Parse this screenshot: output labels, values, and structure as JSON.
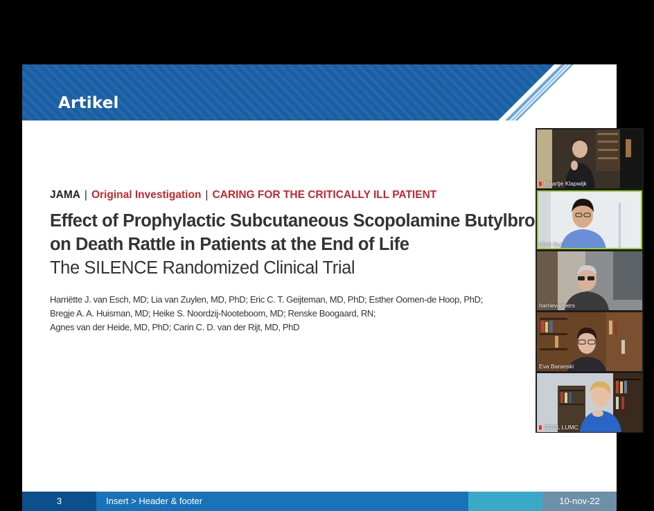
{
  "slide": {
    "title": "Artikel",
    "journal": "JAMA",
    "separator": "|",
    "category_1": "Original Investigation",
    "category_2": "CARING FOR THE CRITICALLY ILL PATIENT",
    "article_title_line_1": "Effect of Prophylactic Subcutaneous Scopolamine Butylbromide",
    "article_title_line_2": "on Death Rattle in Patients at the End of Life",
    "article_subtitle": "The SILENCE Randomized Clinical Trial",
    "authors": [
      "Harriëtte J. van Esch, MD; Lia van Zuylen, MD, PhD; Eric C. T. Geijteman, MD, PhD; Esther Oomen-de Hoop, PhD;",
      "Bregje A. A. Huisman, MD; Heike S. Noordzij-Nooteboom, MD; Renske Boogaard, RN;",
      "Agnes van der Heide, MD, PhD; Carin C. D. van der Rijt, MD, PhD"
    ],
    "footer": {
      "page_number": "3",
      "footer_text": "Insert > Header & footer",
      "date": "10-nov-22"
    }
  },
  "colors": {
    "header_blue": "#1b5fa3",
    "header_stripe": "#6fa8d8",
    "journal_red": "#c0282e",
    "footer_dark_blue": "#0b4f8c",
    "footer_blue": "#1a73b9",
    "footer_teal": "#3aa9c8",
    "footer_grey_blue": "#6d8fa8",
    "speaking_outline": "#9acd32"
  },
  "participants": [
    {
      "name": "Maartje Klapwijk",
      "muted": true,
      "speaking": false
    },
    {
      "name": "Minh Bui",
      "muted": false,
      "speaking": true
    },
    {
      "name": "harrievanoers",
      "muted": false,
      "speaking": false
    },
    {
      "name": "Eva Baranski",
      "muted": false,
      "speaking": false
    },
    {
      "name": "SOOL LUMC",
      "muted": true,
      "speaking": false
    }
  ]
}
